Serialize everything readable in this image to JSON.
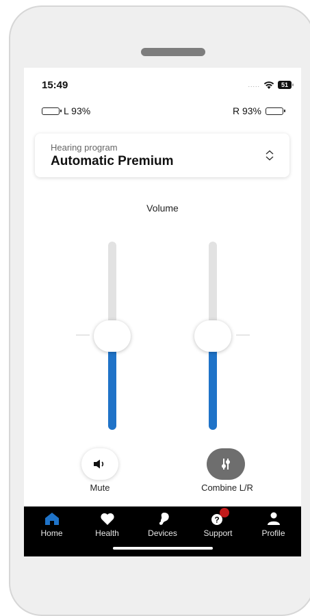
{
  "status_bar": {
    "time": "15:49",
    "signal": ".....",
    "battery_level": "51"
  },
  "hearing_aids": {
    "left_label": "L 93%",
    "right_label": "R 93%",
    "left_battery_pct": 93,
    "right_battery_pct": 93
  },
  "program": {
    "label": "Hearing program",
    "value": "Automatic Premium"
  },
  "volume": {
    "label": "Volume",
    "left_level_pct": 42,
    "right_level_pct": 42
  },
  "actions": {
    "mute_label": "Mute",
    "combine_label": "Combine L/R"
  },
  "tabs": [
    {
      "label": "Home",
      "icon": "home-icon",
      "active": true
    },
    {
      "label": "Health",
      "icon": "heart-icon",
      "active": false
    },
    {
      "label": "Devices",
      "icon": "hearing-aid-icon",
      "active": false
    },
    {
      "label": "Support",
      "icon": "help-icon",
      "active": false
    },
    {
      "label": "Profile",
      "icon": "user-icon",
      "active": false
    }
  ],
  "colors": {
    "accent": "#1f73c8",
    "tab_bar": "#000000",
    "badge": "#c21a1a",
    "combine_button": "#6e6e6e"
  }
}
